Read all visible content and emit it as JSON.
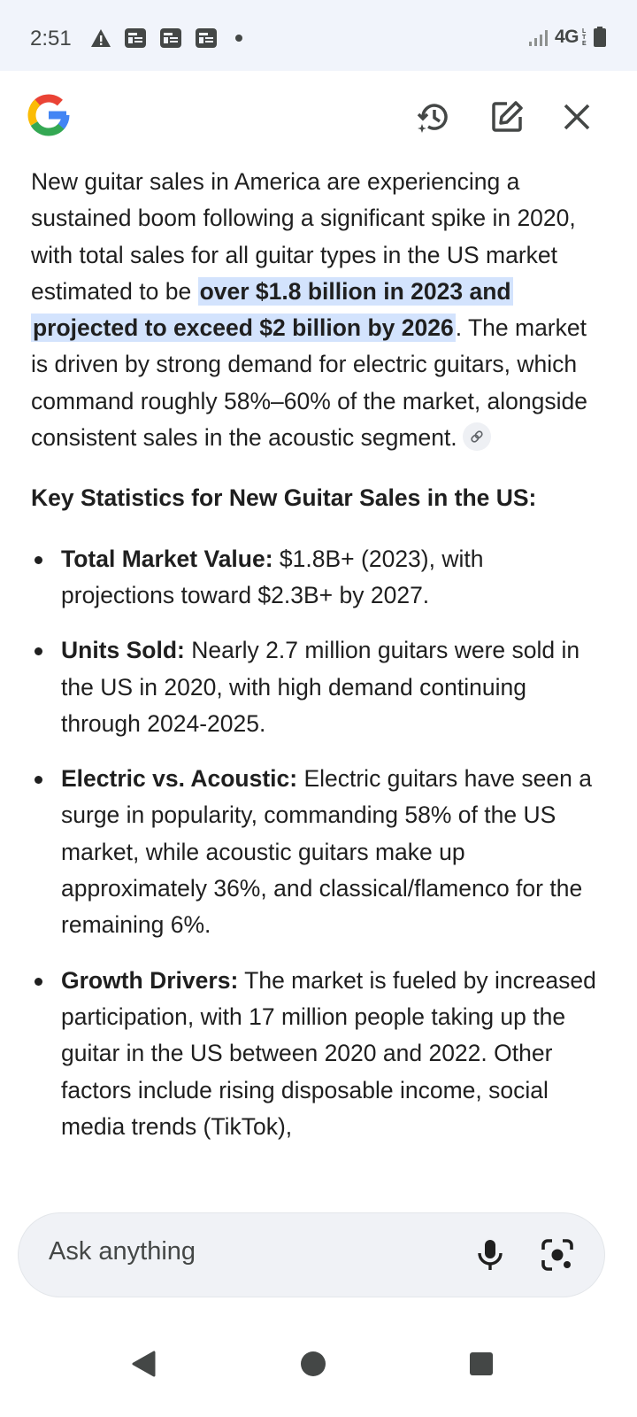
{
  "status": {
    "time": "2:51",
    "network": "4G",
    "network_sub": "LTE",
    "icons": [
      "warning-icon",
      "newspaper-icon",
      "newspaper-icon",
      "newspaper-icon",
      "more-dot-icon",
      "signal-icon",
      "battery-icon"
    ]
  },
  "header": {
    "logo": "google-g-logo",
    "history_icon": "history-sparkle-icon",
    "edit_icon": "edit-icon",
    "close_icon": "close-icon"
  },
  "content": {
    "intro": {
      "pre": "New guitar sales in America are experiencing a sustained boom following a significant spike in 2020, with total sales for all guitar types in the US market estimated to be ",
      "highlight_line1": "over $1.8 billion in 2023",
      "highlight_line2": "and projected to exceed $2 billion by 2026",
      "post": ". The market is driven by strong demand for electric guitars, which command roughly 58%–60% of the market, alongside consistent sales in the acoustic segment."
    },
    "section_title": "Key Statistics for New Guitar Sales in the US:",
    "bullets": [
      {
        "label": "Total Market Value:",
        "text": " $1.8B+ (2023), with projections toward $2.3B+ by 2027."
      },
      {
        "label": "Units Sold:",
        "text": " Nearly 2.7 million guitars were sold in the US in 2020, with high demand continuing through 2024-2025."
      },
      {
        "label": "Electric vs. Acoustic:",
        "text": " Electric guitars have seen a surge in popularity, commanding 58% of the US market, while acoustic guitars make up approximately 36%, and classical/flamenco for the remaining 6%."
      },
      {
        "label": "Growth Drivers:",
        "text": " The market is fueled by increased participation, with 17 million people taking up the guitar in the US between 2020 and 2022. Other factors include rising disposable income, social media trends (TikTok),"
      }
    ]
  },
  "askbar": {
    "placeholder": "Ask anything",
    "mic_icon": "microphone-icon",
    "lens_icon": "camera-lens-icon"
  },
  "navbar": {
    "icons": [
      "back-triangle-icon",
      "home-circle-icon",
      "recents-square-icon"
    ]
  },
  "colors": {
    "highlight": "#d3e3fd",
    "statusbar_bg": "#f1f4fb",
    "askbar_bg": "#f0f2f6",
    "text": "#1f1f1f"
  }
}
